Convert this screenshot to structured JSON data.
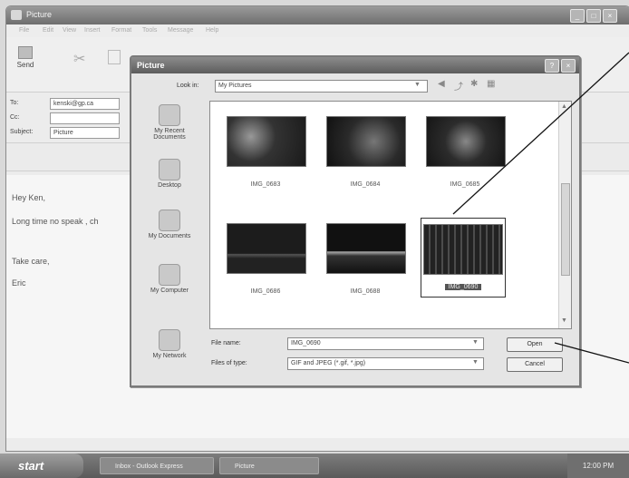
{
  "window": {
    "title": "Picture"
  },
  "menu": {
    "items": [
      "File",
      "Edit",
      "View",
      "Insert",
      "Format",
      "Tools",
      "Message",
      "Help"
    ]
  },
  "toolbar": {
    "send_label": "Send"
  },
  "header": {
    "to_label": "To:",
    "to_value": "kenski@gp.ca",
    "cc_label": "Cc:",
    "cc_value": "",
    "subject_label": "Subject:",
    "subject_value": "Picture"
  },
  "body": {
    "greeting": "Hey Ken,",
    "line1": "Long time no speak , ch",
    "closing": "Take care,",
    "signature": "Eric"
  },
  "dialog": {
    "title": "Picture",
    "look_in_label": "Look in:",
    "look_in_value": "My Pictures",
    "places": [
      "My Recent Documents",
      "Desktop",
      "My Documents",
      "My Computer",
      "My Network"
    ],
    "files": [
      "IMG_0683",
      "IMG_0684",
      "IMG_0685",
      "IMG_0686",
      "IMG_0688",
      "IMG_0690"
    ],
    "selected_file": "IMG_0690",
    "file_name_label": "File name:",
    "file_name_value": "IMG_0690",
    "file_type_label": "Files of type:",
    "file_type_value": "GIF and JPEG (*.gif, *.jpg)",
    "open_label": "Open",
    "cancel_label": "Cancel"
  },
  "taskbar": {
    "start_label": "start",
    "tasks": [
      "Inbox - Outlook Express",
      "Picture"
    ],
    "clock": "12:00 PM"
  }
}
